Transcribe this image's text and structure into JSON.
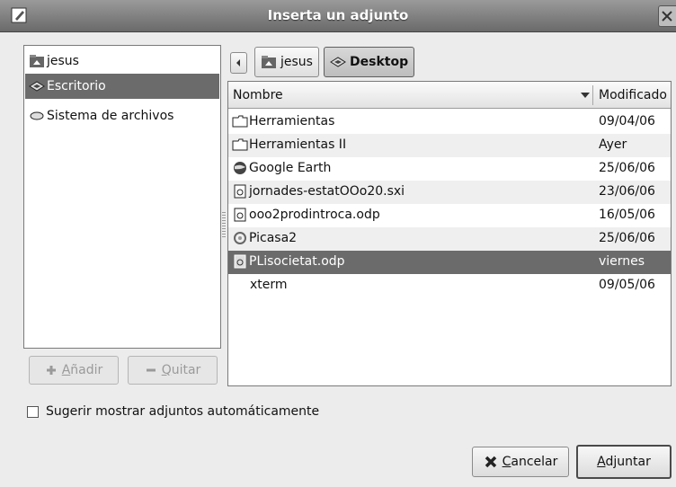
{
  "window": {
    "title": "Inserta un adjunto"
  },
  "places": {
    "items": [
      {
        "label": "jesus",
        "icon": "home-folder-icon",
        "selected": false
      },
      {
        "label": "Escritorio",
        "icon": "desktop-icon",
        "selected": true
      },
      {
        "label": "Sistema de archivos",
        "icon": "drive-icon",
        "selected": false
      }
    ],
    "add_label_mnemonic": "A",
    "add_label_rest": "ñadir",
    "remove_label_mnemonic": "Q",
    "remove_label_rest": "uitar"
  },
  "pathbar": {
    "crumbs": [
      {
        "label": "jesus",
        "icon": "home-folder-icon",
        "active": false
      },
      {
        "label": "Desktop",
        "icon": "desktop-icon",
        "active": true
      }
    ]
  },
  "filelist": {
    "columns": {
      "name": "Nombre",
      "modified": "Modificado"
    },
    "rows": [
      {
        "name": "Herramientas",
        "date": "09/04/06",
        "icon": "folder-icon"
      },
      {
        "name": "Herramientas II",
        "date": "Ayer",
        "icon": "folder-icon"
      },
      {
        "name": "Google Earth",
        "date": "25/06/06",
        "icon": "globe-icon"
      },
      {
        "name": "jornades-estatOOo20.sxi",
        "date": "23/06/06",
        "icon": "presentation-icon"
      },
      {
        "name": "ooo2prodintroca.odp",
        "date": "16/05/06",
        "icon": "presentation-icon"
      },
      {
        "name": "Picasa2",
        "date": "25/06/06",
        "icon": "picasa-icon"
      },
      {
        "name": "PLisocietat.odp",
        "date": "viernes",
        "icon": "presentation-icon",
        "selected": true
      },
      {
        "name": "xterm",
        "date": "09/05/06",
        "icon": "none"
      }
    ]
  },
  "options": {
    "suggest_label": "Sugerir mostrar adjuntos automáticamente",
    "suggest_checked": false
  },
  "buttons": {
    "cancel_mnemonic": "C",
    "cancel_rest": "ancelar",
    "attach_mnemonic": "A",
    "attach_rest": "djuntar"
  }
}
